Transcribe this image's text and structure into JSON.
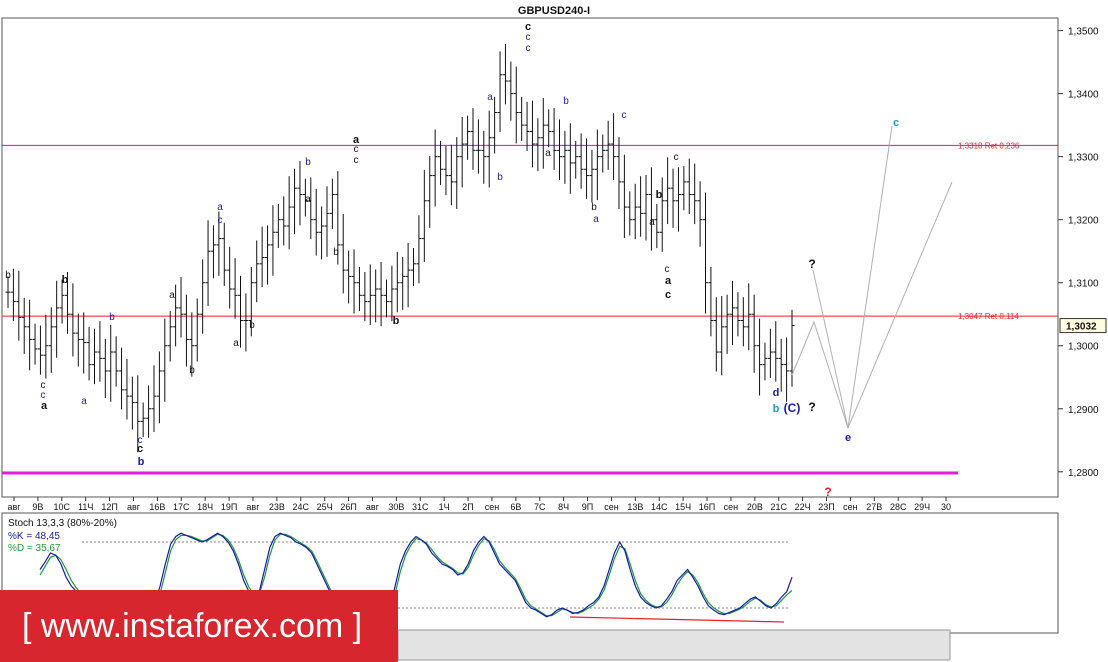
{
  "chart_data": {
    "type": "candlestick",
    "title": "GBPUSD240-I",
    "ylim": [
      1.276,
      1.352
    ],
    "y_ticks": [
      "1,3500",
      "1,3400",
      "1,3300",
      "1,3200",
      "1,3100",
      "1,3000",
      "1,2900",
      "1,2800"
    ],
    "y_tick_values": [
      1.35,
      1.34,
      1.33,
      1.32,
      1.31,
      1.3,
      1.29,
      1.28
    ],
    "current_price": "1,3032",
    "current_price_value": 1.3032,
    "x_tick_labels": [
      "авг",
      "9В",
      "10С",
      "11Ч",
      "12П",
      "авг",
      "16В",
      "17С",
      "18Ч",
      "19П",
      "авг",
      "23В",
      "24С",
      "25Ч",
      "26П",
      "авг",
      "30В",
      "31С",
      "1Ч",
      "2П",
      "сен",
      "6В",
      "7С",
      "8Ч",
      "9П",
      "сен",
      "13В",
      "14С",
      "15Ч",
      "16П",
      "сен",
      "20В",
      "21С",
      "22Ч",
      "23П",
      "сен",
      "27В",
      "28С",
      "29Ч",
      "30"
    ],
    "close_series": [
      1.3085,
      1.307,
      1.3045,
      1.303,
      1.301,
      1.2995,
      1.2985,
      1.3,
      1.303,
      1.306,
      1.308,
      1.305,
      1.302,
      1.301,
      1.3005,
      1.297,
      1.299,
      1.298,
      1.296,
      1.299,
      1.296,
      1.293,
      1.292,
      1.291,
      1.288,
      1.2885,
      1.29,
      1.292,
      1.296,
      1.3,
      1.303,
      1.306,
      1.305,
      1.301,
      1.3,
      1.305,
      1.31,
      1.315,
      1.316,
      1.317,
      1.312,
      1.309,
      1.308,
      1.304,
      1.304,
      1.31,
      1.313,
      1.314,
      1.316,
      1.318,
      1.32,
      1.319,
      1.322,
      1.325,
      1.324,
      1.323,
      1.32,
      1.318,
      1.319,
      1.321,
      1.324,
      1.316,
      1.312,
      1.311,
      1.31,
      1.308,
      1.307,
      1.308,
      1.309,
      1.308,
      1.307,
      1.309,
      1.31,
      1.311,
      1.312,
      1.313,
      1.317,
      1.323,
      1.327,
      1.33,
      1.328,
      1.327,
      1.326,
      1.33,
      1.332,
      1.334,
      1.331,
      1.331,
      1.33,
      1.333,
      1.337,
      1.343,
      1.342,
      1.34,
      1.337,
      1.335,
      1.334,
      1.332,
      1.333,
      1.335,
      1.334,
      1.331,
      1.33,
      1.331,
      1.329,
      1.33,
      1.328,
      1.327,
      1.328,
      1.33,
      1.331,
      1.332,
      1.33,
      1.326,
      1.322,
      1.32,
      1.322,
      1.321,
      1.324,
      1.32,
      1.318,
      1.323,
      1.325,
      1.323,
      1.324,
      1.326,
      1.324,
      1.323,
      1.32,
      1.31,
      1.304,
      1.299,
      1.303,
      1.305,
      1.306,
      1.304,
      1.303,
      1.305,
      1.3,
      1.297,
      1.298,
      1.299,
      1.298,
      1.297,
      1.296,
      1.3032
    ],
    "horizontal_lines": [
      {
        "label": "1,3318 Ret 0,236",
        "value": 1.3318,
        "color": "#e8222a"
      },
      {
        "label": "1,3047 Ret 0,114",
        "value": 1.3047,
        "color": "#e8222a"
      },
      {
        "label": "",
        "value": 1.2798,
        "color": "#e61ae6"
      }
    ],
    "wave_labels": [
      {
        "text": "b",
        "color": "#111111",
        "bold": false
      },
      {
        "text": "b",
        "color": "#111111",
        "bold": true
      },
      {
        "text": "c",
        "color": "#111111",
        "bold": false
      },
      {
        "text": "c",
        "color": "#1a1aaa",
        "bold": false
      },
      {
        "text": "a",
        "color": "#111111",
        "bold": true
      },
      {
        "text": "b",
        "color": "#1a1aaa",
        "bold": false
      },
      {
        "text": "a",
        "color": "#1a1aaa",
        "bold": false
      },
      {
        "text": "c",
        "color": "#1a1aaa",
        "bold": false
      },
      {
        "text": "c",
        "color": "#111111",
        "bold": true
      },
      {
        "text": "b",
        "color": "#1a1aaa",
        "bold": true
      },
      {
        "text": "a",
        "color": "#111111",
        "bold": false
      },
      {
        "text": "b",
        "color": "#111111",
        "bold": false
      },
      {
        "text": "a",
        "color": "#1a1aaa",
        "bold": false
      },
      {
        "text": "c",
        "color": "#1a1aaa",
        "bold": false
      },
      {
        "text": "a",
        "color": "#111111",
        "bold": false
      },
      {
        "text": "b",
        "color": "#111111",
        "bold": false
      },
      {
        "text": "b",
        "color": "#1a1aaa",
        "bold": false
      },
      {
        "text": "a",
        "color": "#111111",
        "bold": false
      },
      {
        "text": "c",
        "color": "#111111",
        "bold": false
      },
      {
        "text": "c",
        "color": "#111111",
        "bold": false
      },
      {
        "text": "a",
        "color": "#111111",
        "bold": true
      },
      {
        "text": "b",
        "color": "#111111",
        "bold": false
      },
      {
        "text": "b",
        "color": "#111111",
        "bold": true
      },
      {
        "text": "a",
        "color": "#1a1aaa",
        "bold": false
      },
      {
        "text": "b",
        "color": "#1a1aaa",
        "bold": false
      },
      {
        "text": "c",
        "color": "#1a1aaa",
        "bold": false
      },
      {
        "text": "c",
        "color": "#1a1aaa",
        "bold": false
      },
      {
        "text": "c",
        "color": "#111111",
        "bold": true
      },
      {
        "text": "a",
        "color": "#111111",
        "bold": false
      },
      {
        "text": "b",
        "color": "#1a1aaa",
        "bold": false
      },
      {
        "text": "c",
        "color": "#1a1aaa",
        "bold": false
      },
      {
        "text": "a",
        "color": "#1a1aaa",
        "bold": false
      },
      {
        "text": "b",
        "color": "#111111",
        "bold": false
      },
      {
        "text": "a",
        "color": "#111111",
        "bold": false
      },
      {
        "text": "b",
        "color": "#111111",
        "bold": true
      },
      {
        "text": "c",
        "color": "#111111",
        "bold": false
      },
      {
        "text": "c",
        "color": "#111111",
        "bold": false
      },
      {
        "text": "a",
        "color": "#111111",
        "bold": true
      },
      {
        "text": "c",
        "color": "#111111",
        "bold": true
      },
      {
        "text": "d",
        "color": "#1a1aaa",
        "bold": true
      },
      {
        "text": "b",
        "color": "#1a9ad6",
        "bold": true
      },
      {
        "text": "(C)",
        "color": "#1a1aaa",
        "bold": true
      },
      {
        "text": "?",
        "color": "#111111",
        "bold": true
      },
      {
        "text": "?",
        "color": "#111111",
        "bold": true
      },
      {
        "text": "e",
        "color": "#1a1aaa",
        "bold": true
      },
      {
        "text": "c",
        "color": "#1a9ad6",
        "bold": true
      },
      {
        "text": "?",
        "color": "#e8222a",
        "bold": true
      }
    ],
    "stochastic": {
      "title": "Stoch 13,3,3 (80%-20%)",
      "k_label": "%K = 48,45",
      "d_label": "%D = 35,67",
      "k_color": "#1a1aaa",
      "d_color": "#1a9a3a",
      "upper_level": 80,
      "lower_level": 20,
      "k_values": [
        55,
        62,
        70,
        68,
        60,
        48,
        40,
        35,
        30,
        22,
        18,
        15,
        20,
        25,
        22,
        18,
        15,
        12,
        10,
        8,
        10,
        15,
        25,
        40,
        60,
        78,
        85,
        88,
        86,
        84,
        82,
        80,
        82,
        85,
        88,
        85,
        80,
        72,
        60,
        45,
        35,
        30,
        35,
        55,
        75,
        85,
        88,
        86,
        84,
        80,
        78,
        75,
        70,
        60,
        50,
        40,
        30,
        20,
        15,
        18,
        22,
        20,
        18,
        15,
        12,
        10,
        14,
        20,
        40,
        60,
        72,
        80,
        85,
        82,
        78,
        70,
        65,
        60,
        58,
        55,
        50,
        52,
        60,
        72,
        80,
        85,
        80,
        70,
        60,
        55,
        50,
        45,
        35,
        25,
        20,
        18,
        15,
        12,
        14,
        18,
        20,
        18,
        15,
        16,
        18,
        22,
        25,
        30,
        40,
        55,
        70,
        80,
        72,
        55,
        40,
        30,
        25,
        22,
        20,
        22,
        28,
        35,
        45,
        50,
        55,
        48,
        40,
        30,
        22,
        18,
        15,
        14,
        16,
        18,
        20,
        24,
        28,
        30,
        26,
        22,
        20,
        24,
        30,
        35,
        48
      ],
      "d_values": [
        50,
        58,
        66,
        68,
        64,
        55,
        45,
        38,
        33,
        26,
        20,
        17,
        18,
        22,
        22,
        20,
        17,
        14,
        11,
        9,
        9,
        12,
        20,
        33,
        52,
        72,
        82,
        86,
        86,
        85,
        83,
        81,
        81,
        84,
        87,
        86,
        82,
        75,
        64,
        50,
        39,
        32,
        33,
        48,
        68,
        82,
        87,
        87,
        85,
        82,
        79,
        76,
        72,
        63,
        53,
        43,
        33,
        24,
        17,
        17,
        20,
        20,
        19,
        16,
        13,
        11,
        12,
        17,
        33,
        53,
        68,
        77,
        83,
        82,
        79,
        73,
        67,
        62,
        59,
        56,
        52,
        51,
        57,
        68,
        77,
        83,
        81,
        73,
        63,
        57,
        52,
        47,
        38,
        28,
        22,
        19,
        16,
        13,
        13,
        16,
        19,
        18,
        16,
        15,
        17,
        20,
        23,
        28,
        36,
        50,
        65,
        76,
        74,
        60,
        45,
        33,
        27,
        23,
        21,
        21,
        25,
        32,
        41,
        48,
        53,
        50,
        43,
        33,
        25,
        20,
        17,
        15,
        15,
        17,
        19,
        22,
        26,
        29,
        27,
        23,
        21,
        22,
        27,
        32,
        36
      ]
    }
  },
  "watermark": "[ www.instaforex.com ]"
}
